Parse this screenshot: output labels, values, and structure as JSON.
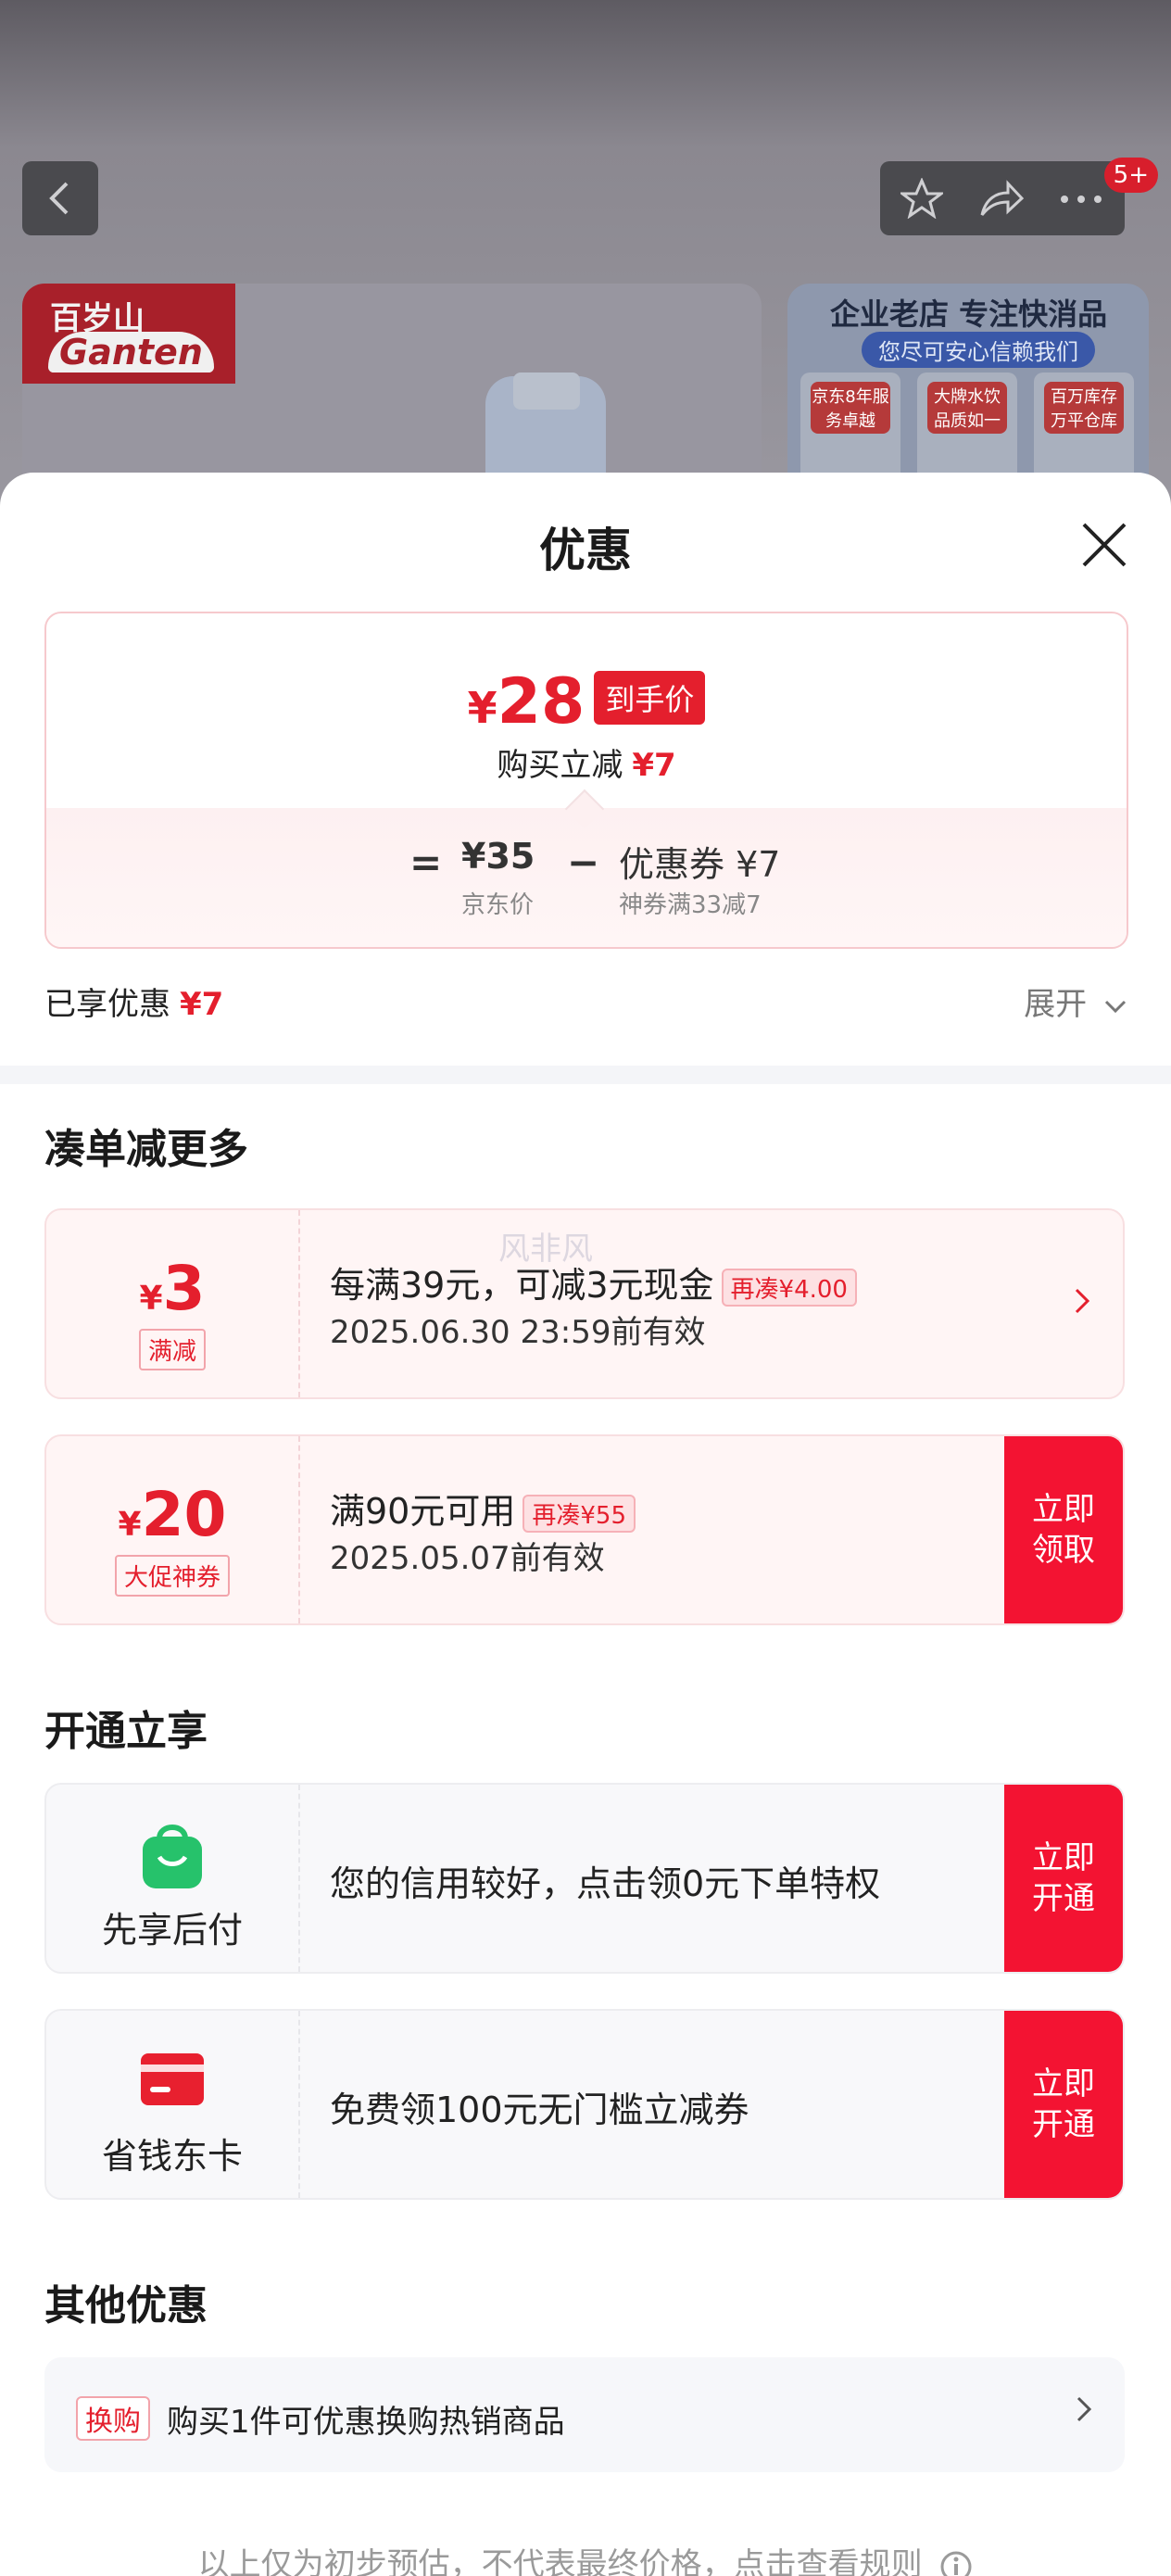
{
  "background": {
    "nav_badge": "5+",
    "shop_logo_top": "百岁山",
    "shop_logo_bottom": "Ganten",
    "ad_title": "企业老店 专注快消品",
    "ad_subtitle": "您尽可安心信赖我们",
    "ad_tiles": [
      "京东8年服务卓越",
      "大牌水饮品质如一",
      "百万库存万平仓库"
    ]
  },
  "sheet": {
    "title": "优惠",
    "price": {
      "yen": "¥",
      "amount": "28",
      "tag": "到手价",
      "sub_label": "购买立减",
      "sub_value": "¥7",
      "formula": {
        "equals": "=",
        "base_value": "¥35",
        "base_label": "京东价",
        "minus": "−",
        "coupon_value": "优惠券 ¥7",
        "coupon_label": "神券满33减7"
      }
    },
    "enjoyed_label": "已享优惠",
    "enjoyed_value": "¥7",
    "expand_label": "展开",
    "section_more": "凑单减更多",
    "watermark": "风非风",
    "coupons": [
      {
        "yen": "¥",
        "amount": "3",
        "label": "满减",
        "main": "每满39元，可减3元现金",
        "tag": "再凑¥4.00",
        "date": "2025.06.30 23:59前有效"
      },
      {
        "yen": "¥",
        "amount": "20",
        "label": "大促神券",
        "main": "满90元可用",
        "tag": "再凑¥55",
        "date": "2025.05.07前有效",
        "button": "立即领取"
      }
    ],
    "section_open": "开通立享",
    "services": [
      {
        "name": "先享后付",
        "text": "您的信用较好，点击领0元下单特权",
        "button": "立即开通",
        "icon": "shopping-bag-icon",
        "color": "#26c26b"
      },
      {
        "name": "省钱东卡",
        "text": "免费领100元无门槛立减券",
        "button": "立即开通",
        "icon": "card-icon",
        "color": "#e8202f"
      }
    ],
    "section_other": "其他优惠",
    "other": {
      "tag": "换购",
      "text": "购买1件可优惠换购热销商品"
    },
    "footnote": "以上仅为初步预估，不代表最终价格，点击查看规则"
  },
  "colors": {
    "accent": "#e41f2d",
    "button": "#f31332"
  }
}
